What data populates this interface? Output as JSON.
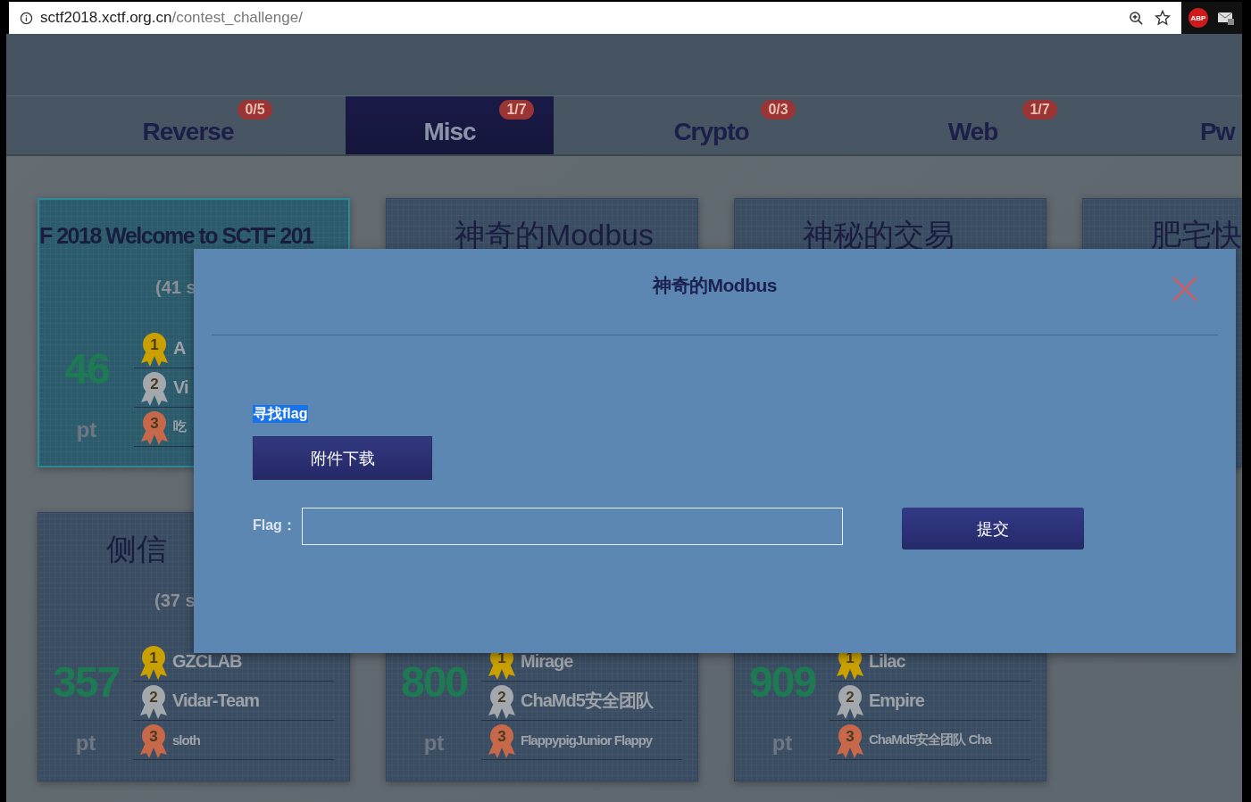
{
  "browser": {
    "url_host": "sctf2018.xctf.org.cn",
    "url_path": "/contest_challenge/",
    "abp_badge": "ABP"
  },
  "tabs": [
    {
      "label": "Reverse",
      "badge": "0/5",
      "selected": false
    },
    {
      "label": "Misc",
      "badge": "1/7",
      "selected": true
    },
    {
      "label": "Crypto",
      "badge": "0/3",
      "selected": false
    },
    {
      "label": "Web",
      "badge": "1/7",
      "selected": false
    },
    {
      "label": "Pw",
      "selected": false
    }
  ],
  "cards": [
    {
      "title": "F 2018  Welcome to SCTF 201",
      "highlighted": true,
      "solves": "(41 s",
      "points": "46",
      "unit": "pt",
      "ranks": [
        {
          "medal": "1",
          "color": "#c9a000",
          "team": "A"
        },
        {
          "medal": "2",
          "color": "#a3a8ad",
          "team": "Vi"
        },
        {
          "medal": "3",
          "color": "#c8684a",
          "team": "吃"
        }
      ]
    },
    {
      "title": "神奇的Modbus",
      "highlighted": false
    },
    {
      "title": "神秘的交易",
      "highlighted": false
    },
    {
      "title": "肥宅快",
      "highlighted": false
    },
    {
      "title": "侧信",
      "highlighted": false,
      "solves": "(37 s",
      "points": "357",
      "unit": "pt",
      "ranks": [
        {
          "medal": "1",
          "color": "#c9a000",
          "team": "GZCLAB"
        },
        {
          "medal": "2",
          "color": "#a3a8ad",
          "team": "Vidar-Team"
        },
        {
          "medal": "3",
          "color": "#c8684a",
          "team": "sloth"
        }
      ]
    },
    {
      "highlighted": false,
      "points": "800",
      "unit": "pt",
      "ranks": [
        {
          "medal": "1",
          "color": "#c9a000",
          "team": "Mirage"
        },
        {
          "medal": "2",
          "color": "#a3a8ad",
          "team": "ChaMd5安全团队"
        },
        {
          "medal": "3",
          "color": "#c8684a",
          "team": "FlappypigJunior  Flappy"
        }
      ]
    },
    {
      "highlighted": false,
      "points": "909",
      "unit": "pt",
      "ranks": [
        {
          "medal": "1",
          "color": "#c9a000",
          "team": "Lilac"
        },
        {
          "medal": "2",
          "color": "#a3a8ad",
          "team": "Empire"
        },
        {
          "medal": "3",
          "color": "#c8684a",
          "team": "ChaMd5安全团队  Cha"
        }
      ]
    }
  ],
  "modal": {
    "title": "神奇的Modbus",
    "description": "寻找flag",
    "download_button": "附件下载",
    "flag_label": "Flag：",
    "submit_button": "提交"
  }
}
